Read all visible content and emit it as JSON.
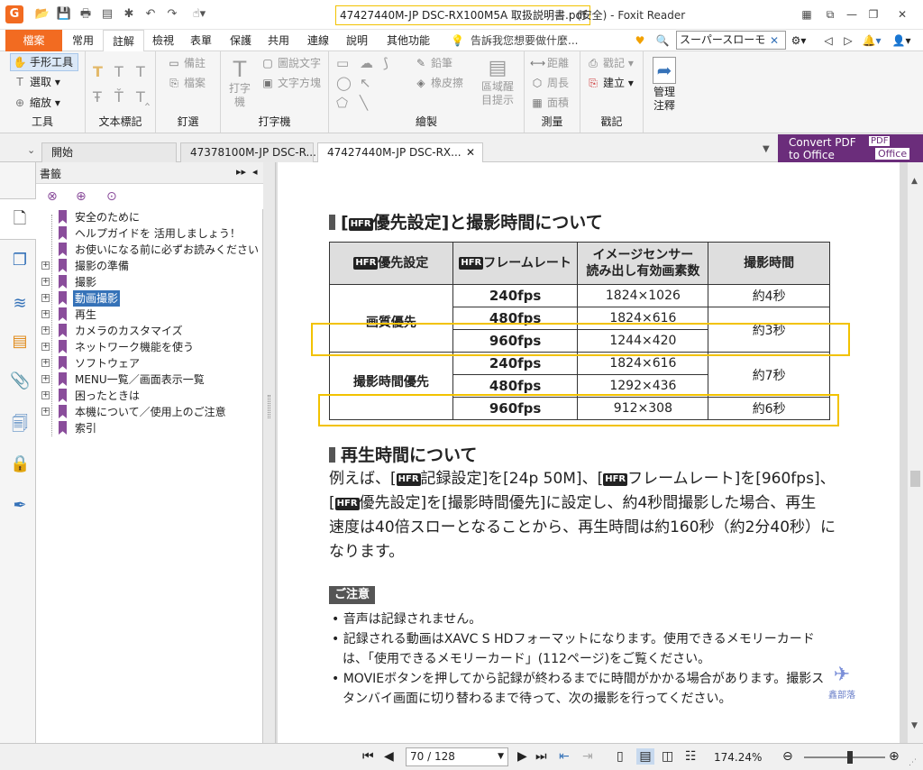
{
  "window": {
    "doc_title": "47427440M-JP DSC-RX100M5A 取扱説明書.pdf",
    "app_title": "(安全) - Foxit Reader"
  },
  "menu": {
    "tabs": [
      "檔案",
      "常用",
      "註解",
      "檢視",
      "表單",
      "保護",
      "共用",
      "連線",
      "說明",
      "其他功能"
    ],
    "tellme": "告訴我您想要做什麼...",
    "search_value": "スーパースローモ"
  },
  "ribbon": {
    "tools": {
      "hand": "手形工具",
      "select": "選取",
      "zoom": "縮放",
      "label": "工具"
    },
    "text_markup": {
      "label": "文本標記"
    },
    "pin": {
      "note": "備註",
      "file": "檔案",
      "label": "釘選"
    },
    "typewriter": {
      "typewriter": "打字機",
      "callout": "圖說文字",
      "textbox": "文字方塊",
      "label": "打字機"
    },
    "drawing": {
      "pencil": "鉛筆",
      "eraser": "橡皮擦",
      "area_highlight": "區域醒目提示",
      "label": "繪製"
    },
    "measure": {
      "distance": "距離",
      "perimeter": "周長",
      "area": "面積",
      "label": "測量"
    },
    "stamp": {
      "stamp": "戳記",
      "create": "建立",
      "label": "戳記"
    },
    "manage": {
      "label": "管理注釋"
    }
  },
  "doctabs": [
    "開始",
    "47378100M-JP DSC-R...",
    "47427440M-JP DSC-RX..."
  ],
  "convert": {
    "line1": "Convert PDF",
    "line2": "to Office",
    "badge_pdf": "PDF",
    "badge_office": "Office"
  },
  "bookmarks": {
    "title": "書籤",
    "items": [
      {
        "label": "安全のために",
        "expandable": false
      },
      {
        "label": "ヘルプガイドを 活用しましょう！",
        "expandable": false
      },
      {
        "label": "お使いになる前に必ずお読みください",
        "expandable": false
      },
      {
        "label": "撮影の準備",
        "expandable": true
      },
      {
        "label": "撮影",
        "expandable": true
      },
      {
        "label": "動画撮影",
        "expandable": true,
        "selected": true
      },
      {
        "label": "再生",
        "expandable": true
      },
      {
        "label": "カメラのカスタマイズ",
        "expandable": true
      },
      {
        "label": "ネットワーク機能を使う",
        "expandable": true
      },
      {
        "label": "ソフトウェア",
        "expandable": true
      },
      {
        "label": "MENU一覧／画面表示一覧",
        "expandable": true
      },
      {
        "label": "困ったときは",
        "expandable": true
      },
      {
        "label": "本機について／使用上のご注意",
        "expandable": true
      },
      {
        "label": "索引",
        "expandable": false
      }
    ]
  },
  "pdf": {
    "hfr": "HFR",
    "heading1_pre": "[",
    "heading1_mid": "優先設定]と撮影時間について",
    "table": {
      "headers": [
        "優先設定",
        "フレームレート",
        "イメージセンサー\n読み出し有効画素数",
        "撮影時間"
      ],
      "groups": [
        "画質優先",
        "撮影時間優先"
      ],
      "rows": [
        [
          "240fps",
          "1824×1026",
          "約4秒"
        ],
        [
          "480fps",
          "1824×616",
          ""
        ],
        [
          "960fps",
          "1244×420",
          "約3秒"
        ],
        [
          "240fps",
          "1824×616",
          ""
        ],
        [
          "480fps",
          "1292×436",
          "約7秒"
        ],
        [
          "960fps",
          "912×308",
          "約6秒"
        ]
      ]
    },
    "heading2": "再生時間について",
    "para": "例えば、[HFR記録設定]を[24p 50M]、[HFRフレームレート]を[960fps]、[HFR優先設定]を[撮影時間優先]に設定し、約4秒間撮影した場合、再生速度は40倍スローとなることから、再生時間は約160秒（約2分40秒）になります。",
    "para_lines": [
      "例えば、[",
      "記録設定]を[24p 50M]、[",
      "フレームレート]を[960fps]、",
      "[",
      "優先設定]を[撮影時間優先]に設定し、約4秒間撮影した場合、再生",
      "速度は40倍スローとなることから、再生時間は約160秒（約2分40秒）に",
      "なります。"
    ],
    "note": "ご注意",
    "bullets": [
      "音声は記録されません。",
      "記録される動画はXAVC S HDフォーマットになります。使用できるメモリーカードは、「使用できるメモリーカード」(112ページ)をご覧ください。",
      "MOVIEボタンを押してから記録が終わるまでに時間がかかる場合があります。撮影スタンバイ画面に切り替わるまで待って、次の撮影を行ってください。"
    ],
    "watermark": "鑫部落"
  },
  "status": {
    "page": "70 / 128",
    "zoom": "174.24%"
  }
}
